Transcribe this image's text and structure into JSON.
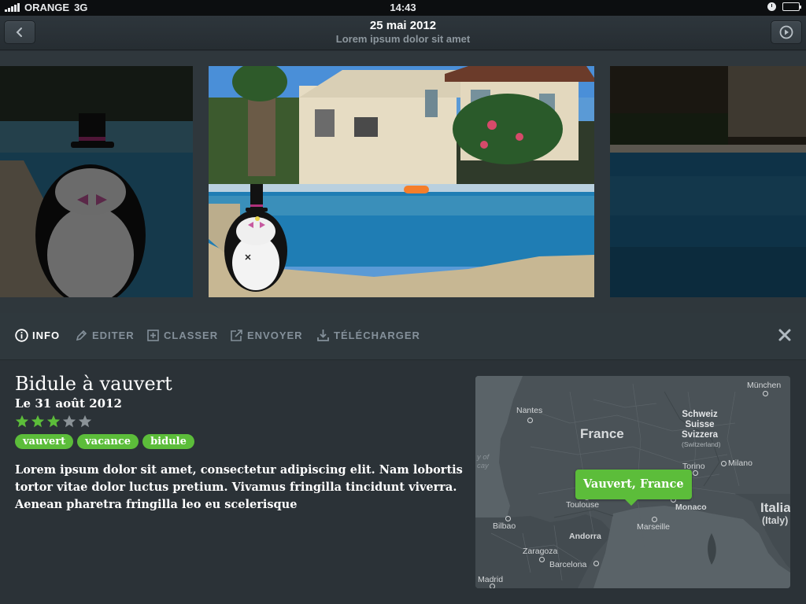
{
  "status_bar": {
    "carrier": "ORANGE",
    "network": "3G",
    "time": "14:43"
  },
  "navbar": {
    "title": "25 mai 2012",
    "subtitle": "Lorem ipsum dolor sit amet"
  },
  "toolbar": {
    "tabs": [
      {
        "label": "INFO",
        "icon": "info-icon",
        "active": true
      },
      {
        "label": "EDITER",
        "icon": "pencil-icon"
      },
      {
        "label": "CLASSER",
        "icon": "add-to-album-icon"
      },
      {
        "label": "ENVOYER",
        "icon": "share-icon"
      },
      {
        "label": "TÉLÉCHARGER",
        "icon": "download-icon"
      }
    ]
  },
  "photo": {
    "title": "Bidule à vauvert",
    "date": "Le 31 août 2012",
    "rating": 3,
    "rating_max": 5,
    "tags": [
      "vauvert",
      "vacance",
      "bidule"
    ],
    "description": "Lorem ipsum dolor sit amet, consectetur adipiscing elit. Nam lobortis tortor vitae dolor luctus pretium. Vivamus fringilla tincidunt viverra. Aenean pharetra fringilla leo eu scelerisque"
  },
  "map": {
    "pin_label": "Vauvert, France",
    "country_label": "France",
    "switzerland_label": "Schweiz\nSuisse\nSvizzera",
    "switzerland_sub": "(Switzerland)",
    "italy_label": "Italia",
    "italy_sub": "(Italy)",
    "bay_label": "y of\ncay",
    "cities": {
      "nantes": "Nantes",
      "munchen": "München",
      "torino": "Torino",
      "milano": "Milano",
      "toulouse": "Toulouse",
      "monaco": "Monaco",
      "bilbao": "Bilbao",
      "andorra": "Andorra",
      "marseille": "Marseille",
      "zaragoza": "Zaragoza",
      "barcelona": "Barcelona",
      "madrid": "Madrid"
    }
  },
  "colors": {
    "accent_green": "#5cbd3a",
    "star_empty": "#8a9297",
    "panel_bg": "#2b3237"
  }
}
